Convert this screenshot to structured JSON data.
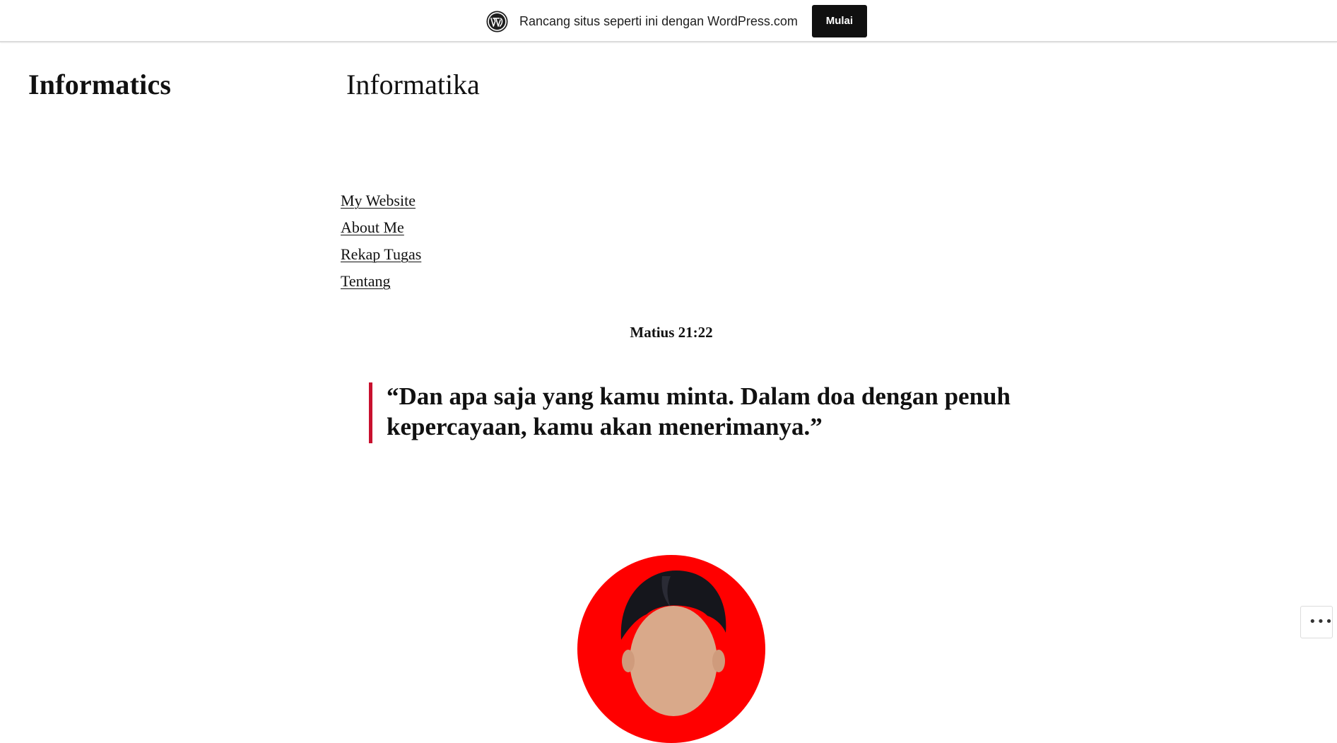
{
  "promo": {
    "icon": "wordpress-logo-icon",
    "text": "Rancang situs seperti ini dengan WordPress.com",
    "button_label": "Mulai"
  },
  "header": {
    "site_title": "Informatics",
    "tagline": "Informatika"
  },
  "nav": {
    "items": [
      {
        "label": "My Website"
      },
      {
        "label": "About Me"
      },
      {
        "label": "Rekap Tugas"
      },
      {
        "label": "Tentang"
      }
    ]
  },
  "content": {
    "verse_reference": "Matius 21:22",
    "quote": "“Dan apa saja yang kamu minta. Dalam doa dengan penuh kepercayaan, kamu akan menerimanya.”",
    "quote_accent_color": "#c8102e",
    "profile_background_color": "#ff0000"
  },
  "actions": {
    "more_icon": "more-horizontal-icon"
  }
}
